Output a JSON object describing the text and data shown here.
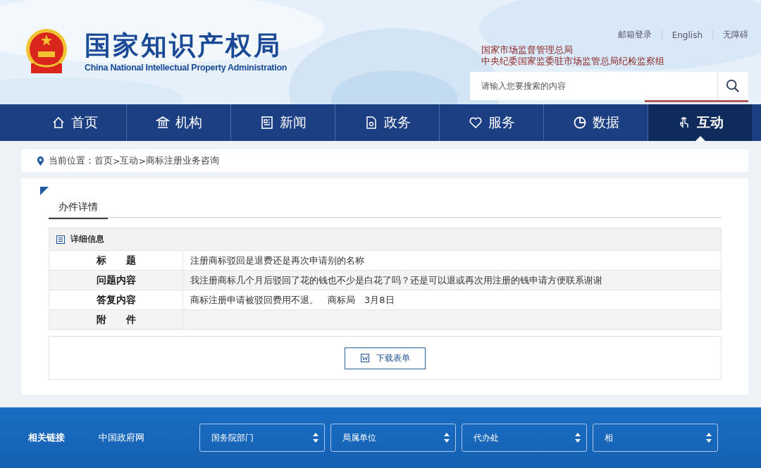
{
  "header": {
    "title": "国家知识产权局",
    "subtitle": "China National Intellectual Property Administration",
    "top_links": [
      "邮箱登录",
      "English",
      "无障碍"
    ],
    "affiliations": [
      "国家市场监督管理总局",
      "中央纪委国家监委驻市场监管总局纪检监察组"
    ],
    "search": {
      "placeholder": "请输入您要搜索的内容"
    }
  },
  "nav": [
    {
      "label": "首页",
      "selected": false
    },
    {
      "label": "机构",
      "selected": false
    },
    {
      "label": "新闻",
      "selected": false
    },
    {
      "label": "政务",
      "selected": false
    },
    {
      "label": "服务",
      "selected": false
    },
    {
      "label": "数据",
      "selected": false
    },
    {
      "label": "互动",
      "selected": true
    }
  ],
  "breadcrumb": {
    "label": "当前位置：",
    "items": [
      "首页",
      ">",
      "互动",
      ">",
      "商标注册业务咨询"
    ]
  },
  "detail": {
    "tab": "办件详情",
    "section": "详细信息",
    "rows": [
      {
        "label": "标题",
        "value": "注册商标驳回是退费还是再次申请别的名称"
      },
      {
        "label": "问题内容",
        "value": "我注册商标几个月后驳回了花的钱也不少是白花了吗？还是可以退或再次用注册的钱申请方便联系谢谢"
      },
      {
        "label": "答复内容",
        "value": "商标注册申请被驳回费用不退。　商标局　3月8日"
      },
      {
        "label": "附件"
      }
    ],
    "download": "下载表单"
  },
  "footer": {
    "label": "相关链接",
    "link": "中国政府网",
    "selects": [
      "国务院部门",
      "局属单位",
      "代办处",
      "相"
    ]
  }
}
